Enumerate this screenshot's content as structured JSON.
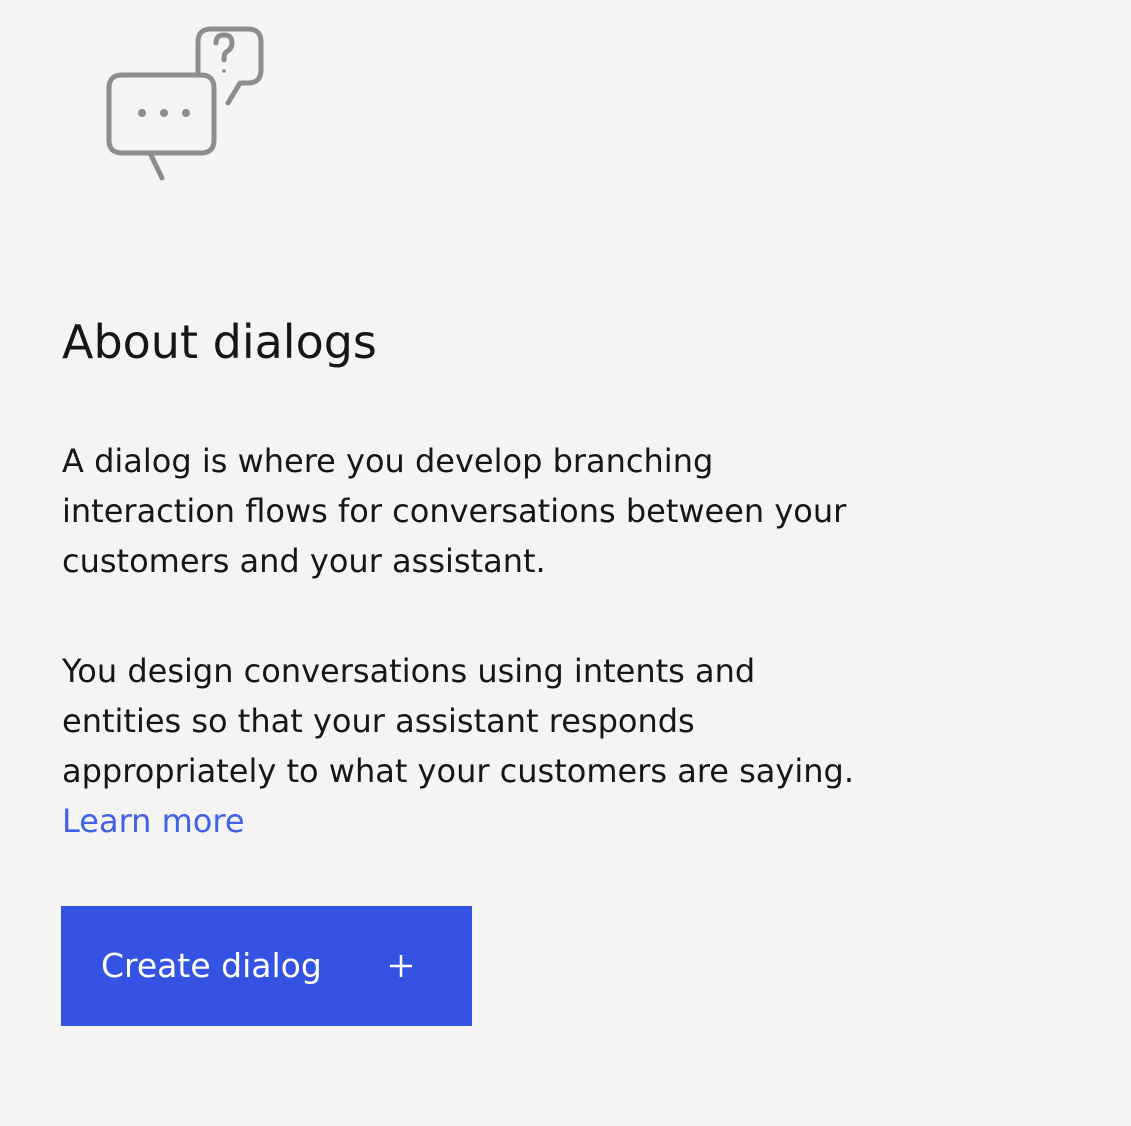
{
  "illustration": {
    "icon": "chat-bubbles-question-icon",
    "color": "#8d8d8d"
  },
  "content": {
    "title": "About dialogs",
    "paragraph1": "A dialog is where you develop branching interaction flows for conversations between your customers and your assistant.",
    "paragraph2": "You design conversations using intents and entities so that your assistant responds appropriately to what your customers are saying.",
    "learn_more_label": "Learn more"
  },
  "actions": {
    "create_label": "Create dialog",
    "create_icon": "plus-icon"
  },
  "colors": {
    "background": "#f4f4f4",
    "text": "#161616",
    "link": "#4162e5",
    "primary_button": "#3453e3"
  }
}
